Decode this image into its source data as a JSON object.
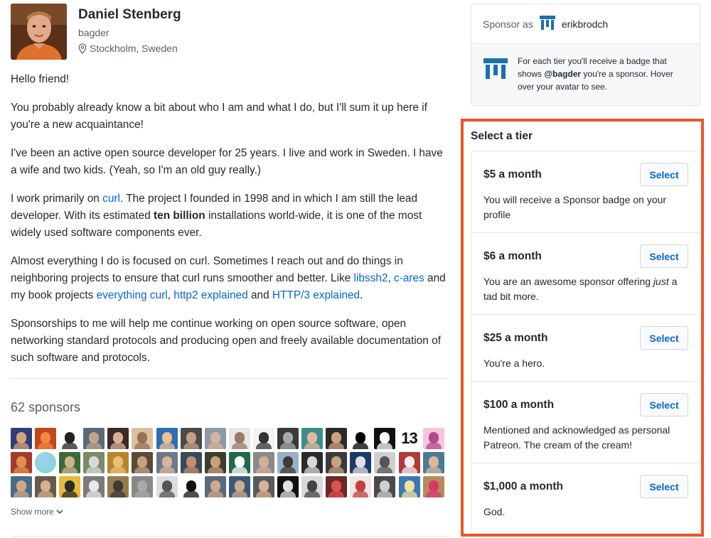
{
  "profile": {
    "name": "Daniel Stenberg",
    "login": "bagder",
    "location": "Stockholm, Sweden"
  },
  "bio": {
    "p1": "Hello friend!",
    "p2": "You probably already know a bit about who I am and what I do, but I'll sum it up here if you're a new acquaintance!",
    "p3": "I've been an active open source developer for 25 years. I live and work in Sweden. I have a wife and two kids. (Yeah, so I'm an old guy really.)",
    "p4_a": "I work primarily on ",
    "p4_link_curl": "curl",
    "p4_b": ". The project I founded in 1998 and in which I am still the lead developer. With its estimated ",
    "p4_bold": "ten billion",
    "p4_c": " installations world-wide, it is one of the most widely used software components ever.",
    "p5_a": "Almost everything I do is focused on curl. Sometimes I reach out and do things in neighboring projects to ensure that curl runs smoother and better. Like ",
    "p5_link_libssh2": "libssh2",
    "p5_sep1": ", ",
    "p5_link_cares": "c-ares",
    "p5_b": " and my book projects ",
    "p5_link_everything": "everything curl",
    "p5_sep2": ", ",
    "p5_link_http2": "http2 explained",
    "p5_c": " and ",
    "p5_link_http3": "HTTP/3 explained",
    "p5_d": ".",
    "p6": "Sponsorships to me will help me continue working on open source software, open networking standard protocols and producing open and freely available documentation of such software and protocols."
  },
  "sponsors": {
    "count_label": "62 sponsors",
    "show_more": "Show more",
    "avatars": [
      {
        "bg": "#2f3e7a",
        "fg": "#d9a37a"
      },
      {
        "bg": "#c2461f",
        "fg": "#f08a3c"
      },
      {
        "bg": "#ffffff",
        "fg": "#222222"
      },
      {
        "bg": "#5a6a7a",
        "fg": "#c4a48a"
      },
      {
        "bg": "#3a2a2a",
        "fg": "#d8b09a"
      },
      {
        "bg": "#d9c1a0",
        "fg": "#9a6f55"
      },
      {
        "bg": "#2c6fb0",
        "fg": "#f0c090"
      },
      {
        "bg": "#4a4a4a",
        "fg": "#c79f84"
      },
      {
        "bg": "#8a9ba8",
        "fg": "#d6b39a"
      },
      {
        "bg": "#e6e6e6",
        "fg": "#9a7a66"
      },
      {
        "bg": "#f2f2f2",
        "fg": "#333333"
      },
      {
        "bg": "#3a3a3a",
        "fg": "#a9a9a9"
      },
      {
        "bg": "#3d8e8a",
        "fg": "#e1b89c"
      },
      {
        "bg": "#2a2a2a",
        "fg": "#d0a080"
      },
      {
        "bg": "#ffffff",
        "fg": "#000000"
      },
      {
        "bg": "#111111",
        "fg": "#ffffff"
      },
      {
        "bg": "#ffffff",
        "fg": "#000000",
        "text": "13"
      },
      {
        "bg": "#f6c6dc",
        "fg": "#b5478c"
      },
      {
        "bg": "#a63a2a",
        "fg": "#e0904a"
      },
      {
        "bg": "#7ad6c9",
        "fg": "#9fd2f0",
        "round": true
      },
      {
        "bg": "#3a6a3a",
        "fg": "#d1b48a"
      },
      {
        "bg": "#7a8a6a",
        "fg": "#d9d9d9"
      },
      {
        "bg": "#b8862a",
        "fg": "#e6c07a"
      },
      {
        "bg": "#5a4a3a",
        "fg": "#c9a182"
      },
      {
        "bg": "#6a7a8a",
        "fg": "#d7b49b"
      },
      {
        "bg": "#3a4a5a",
        "fg": "#c09070"
      },
      {
        "bg": "#3a3f2a",
        "fg": "#c8a07a"
      },
      {
        "bg": "#1f6a4a",
        "fg": "#ffffff"
      },
      {
        "bg": "#8a8a8a",
        "fg": "#d0b09a"
      },
      {
        "bg": "#9ab0c8",
        "fg": "#3a3a3a"
      },
      {
        "bg": "#2a2a2a",
        "fg": "#d8d8d8"
      },
      {
        "bg": "#3a3a3a",
        "fg": "#c9a080"
      },
      {
        "bg": "#1a3a6a",
        "fg": "#e0e0e0"
      },
      {
        "bg": "#cfcfcf",
        "fg": "#555555"
      },
      {
        "bg": "#b03a3a",
        "fg": "#f0f0f0"
      },
      {
        "bg": "#4a7a9a",
        "fg": "#d9b89a"
      },
      {
        "bg": "#4a6a8a",
        "fg": "#d0a888"
      },
      {
        "bg": "#6a5a4a",
        "fg": "#d6b091"
      },
      {
        "bg": "#e6b93a",
        "fg": "#2a2a2a"
      },
      {
        "bg": "#7a7a7a",
        "fg": "#e9e9e9"
      },
      {
        "bg": "#9a7a4a",
        "fg": "#3a3a3a"
      },
      {
        "bg": "#888888",
        "fg": "#aaaaaa"
      },
      {
        "bg": "#dcdcdc",
        "fg": "#555555"
      },
      {
        "bg": "#ffffff",
        "fg": "#111111"
      },
      {
        "bg": "#5a6a7a",
        "fg": "#cfa98c"
      },
      {
        "bg": "#3a5a7a",
        "fg": "#d2aa8a"
      },
      {
        "bg": "#5a5a5a",
        "fg": "#d8b396"
      },
      {
        "bg": "#111111",
        "fg": "#e0e0e0"
      },
      {
        "bg": "#d9d9d9",
        "fg": "#444444"
      },
      {
        "bg": "#6a2a2a",
        "fg": "#e05050"
      },
      {
        "bg": "#f0e6e6",
        "fg": "#c04040"
      },
      {
        "bg": "#4a4a4a",
        "fg": "#cfcfcf"
      },
      {
        "bg": "#3a7ab0",
        "fg": "#f4e0a0"
      },
      {
        "bg": "#b88a5a",
        "fg": "#d43a6a"
      }
    ]
  },
  "sponsor_as": {
    "label": "Sponsor as",
    "username": "erikbrodch",
    "info_a": "For each tier you'll receive a badge that shows ",
    "info_handle": "@bagder",
    "info_b": " you're a sponsor. Hover over your avatar to see."
  },
  "tiers": {
    "title": "Select a tier",
    "select_label": "Select",
    "t1": {
      "name": "$5 a month",
      "desc": "You will receive a Sponsor badge on your profile"
    },
    "t2": {
      "name": "$6 a month",
      "desc_a": "You are an awesome sponsor offering ",
      "desc_em": "just",
      "desc_b": " a tad bit more."
    },
    "t3": {
      "name": "$25 a month",
      "desc": "You're a hero."
    },
    "t4": {
      "name": "$100 a month",
      "desc": "Mentioned and acknowledged as personal Patreon. The cream of the cream!"
    },
    "t5": {
      "name": "$1,000 a month",
      "desc": "God."
    }
  },
  "colors": {
    "link": "#0366d6",
    "highlight": "#e8562a",
    "logo": "#1a6fb0"
  }
}
